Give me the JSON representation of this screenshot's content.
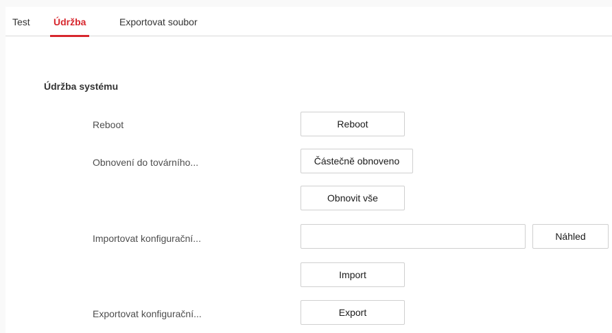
{
  "tabs": [
    {
      "label": "Test",
      "active": false
    },
    {
      "label": "Údržba",
      "active": true
    },
    {
      "label": "Exportovat soubor",
      "active": false
    }
  ],
  "colors": {
    "accent": "#d7262d",
    "background": "#f9f9f9",
    "panel": "#ffffff",
    "border": "#cfcfcf"
  },
  "section": {
    "title": "Údržba systému"
  },
  "reboot": {
    "label": "Reboot",
    "button": "Reboot"
  },
  "factory_reset": {
    "label": "Obnovení do továrního...",
    "partial_button": "Částečně obnoveno",
    "full_button": "Obnovit vše"
  },
  "import_config": {
    "label": "Importovat konfigurační...",
    "file_value": "",
    "browse_button": "Náhled",
    "import_button": "Import"
  },
  "export_config": {
    "label": "Exportovat konfigurační...",
    "export_button": "Export"
  }
}
